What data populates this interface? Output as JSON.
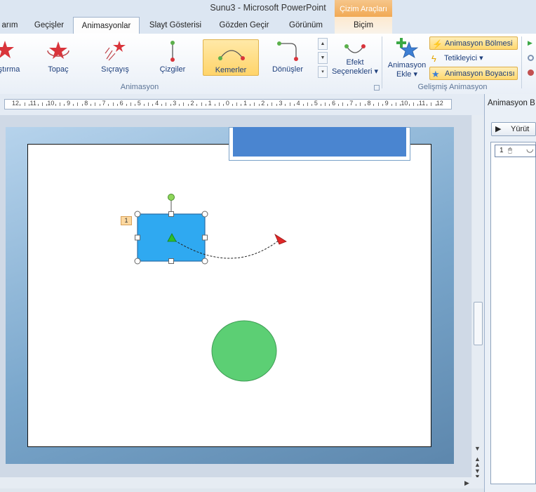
{
  "window": {
    "title": "Sunu3  -  Microsoft PowerPoint",
    "context_group": "Çizim Araçları"
  },
  "tabs": [
    {
      "label": "arım"
    },
    {
      "label": "Geçişler"
    },
    {
      "label": "Animasyonlar"
    },
    {
      "label": "Slayt Gösterisi"
    },
    {
      "label": "Gözden Geçir"
    },
    {
      "label": "Görünüm"
    },
    {
      "label": "Biçim"
    }
  ],
  "ribbon": {
    "gallery": [
      {
        "label": "aştırma",
        "icon": "star-burst-icon"
      },
      {
        "label": "Topaç",
        "icon": "spinning-star-icon"
      },
      {
        "label": "Sıçrayış",
        "icon": "bouncing-star-icon"
      },
      {
        "label": "Çizgiler",
        "icon": "line-path-icon"
      },
      {
        "label": "Kemerler",
        "icon": "arc-path-icon"
      },
      {
        "label": "Dönüşler",
        "icon": "turn-path-icon"
      }
    ],
    "effect_options": {
      "line1": "Efekt",
      "line2": "Seçenekleri ▾"
    },
    "animation_group_label": "Animasyon",
    "add_animation": {
      "line1": "Animasyon",
      "line2": "Ekle ▾"
    },
    "animation_pane": "Animasyon Bölmesi",
    "trigger": "Tetikleyici ▾",
    "animation_painter": "Animasyon Boyacısı",
    "advanced_group_label": "Gelişmiş Animasyon"
  },
  "ruler": {
    "labels": [
      "12",
      "11",
      "10",
      "9",
      "8",
      "7",
      "6",
      "5",
      "4",
      "3",
      "2",
      "1",
      "0",
      "1",
      "2",
      "3",
      "4",
      "5",
      "6",
      "7",
      "8",
      "9",
      "10",
      "11",
      "12"
    ]
  },
  "slide": {
    "animation_tag": "1"
  },
  "pane": {
    "title": "Animasyon B",
    "play_label": "Yürüt",
    "item_number": "1"
  },
  "colors": {
    "accent_blue": "#4a85d0",
    "shape_fill": "#2fa9f1",
    "circle_fill": "#5ccf74",
    "highlight": "#ffd86e"
  }
}
